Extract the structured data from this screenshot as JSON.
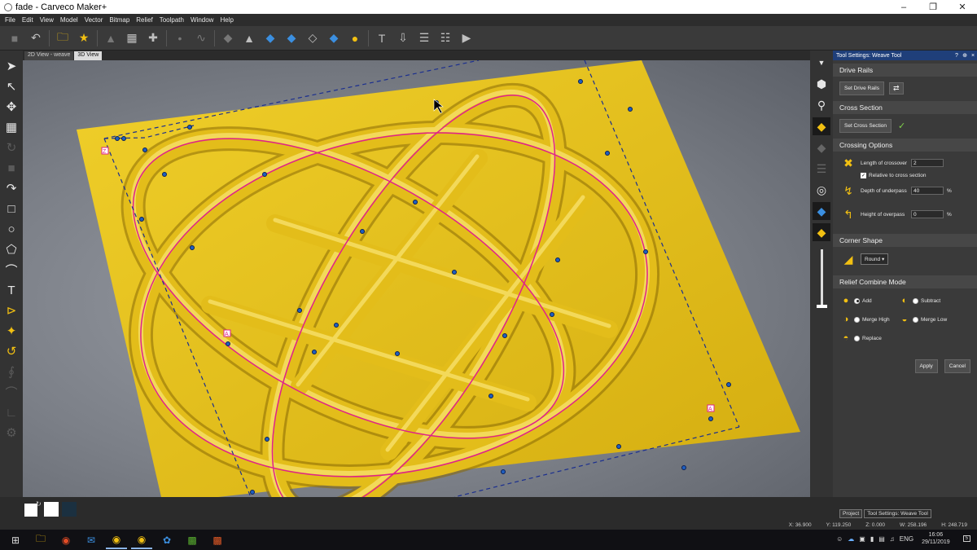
{
  "window": {
    "title": "fade - Carveco Maker+",
    "minimize": "–",
    "maximize": "❐",
    "close": "✕"
  },
  "menu": [
    "File",
    "Edit",
    "View",
    "Model",
    "Vector",
    "Bitmap",
    "Relief",
    "Toolpath",
    "Window",
    "Help"
  ],
  "view_tabs": {
    "tab_2d": "2D View - weave",
    "tab_3d": "3D View"
  },
  "panel": {
    "title": "Tool Settings: Weave Tool",
    "help": "?",
    "pin": "⊕",
    "close": "×",
    "drive_rails": {
      "heading": "Drive Rails",
      "button": "Set Drive Rails",
      "swap_icon": "⇄"
    },
    "cross_section": {
      "heading": "Cross Section",
      "button": "Set Cross Section",
      "check": "✓"
    },
    "crossing_options": {
      "heading": "Crossing Options",
      "length_label": "Length of crossover",
      "length_value": "2",
      "relative_label": "Relative to cross section",
      "relative_checked": "✓",
      "depth_label": "Depth of underpass",
      "depth_value": "40",
      "depth_unit": "%",
      "height_label": "Height of overpass",
      "height_value": "0",
      "height_unit": "%"
    },
    "corner_shape": {
      "heading": "Corner Shape",
      "value": "Round",
      "arrow": "▾"
    },
    "combine": {
      "heading": "Relief Combine Mode",
      "add": "Add",
      "subtract": "Subtract",
      "merge_high": "Merge High",
      "merge_low": "Merge Low",
      "replace": "Replace",
      "selected": "Add"
    },
    "apply": "Apply",
    "cancel": "Cancel"
  },
  "panel_tabs": {
    "project": "Project",
    "tool_settings": "Tool Settings: Weave Tool"
  },
  "status": {
    "x": "X: 36.900",
    "y": "Y: 119.250",
    "z": "Z: 0.000",
    "w": "W: 258.196",
    "h": "H: 248.719"
  },
  "swatch_colors": {
    "primary": "#ffffff",
    "secondary": "#ffffff",
    "tertiary": "#1b3040"
  },
  "viewport": {
    "background": "#8b8f97",
    "relief_color": "#e8c21a",
    "rail_color": "#e0218a",
    "guide_color": "#1b2f8f",
    "markers": {
      "start": "Z",
      "mid": "A"
    }
  },
  "taskbar": {
    "tray_lang": "ENG",
    "time": "16:06",
    "date": "29/11/2019",
    "notification_count": "5"
  },
  "icons": {
    "toolbar": [
      "save-icon",
      "undo-icon",
      "open-folder-icon",
      "favourite-folder-icon",
      "move-icon",
      "transform-icon",
      "add-icon",
      "node-icon",
      "smooth-icon",
      "relief-flat-icon",
      "relief-raise-icon",
      "relief-add-icon",
      "relief-merge-icon",
      "relief-subtract-icon",
      "relief-replace-icon",
      "water-drop-icon",
      "text-icon",
      "import-icon",
      "stack-icon",
      "texture-icon",
      "pan-icon"
    ]
  }
}
